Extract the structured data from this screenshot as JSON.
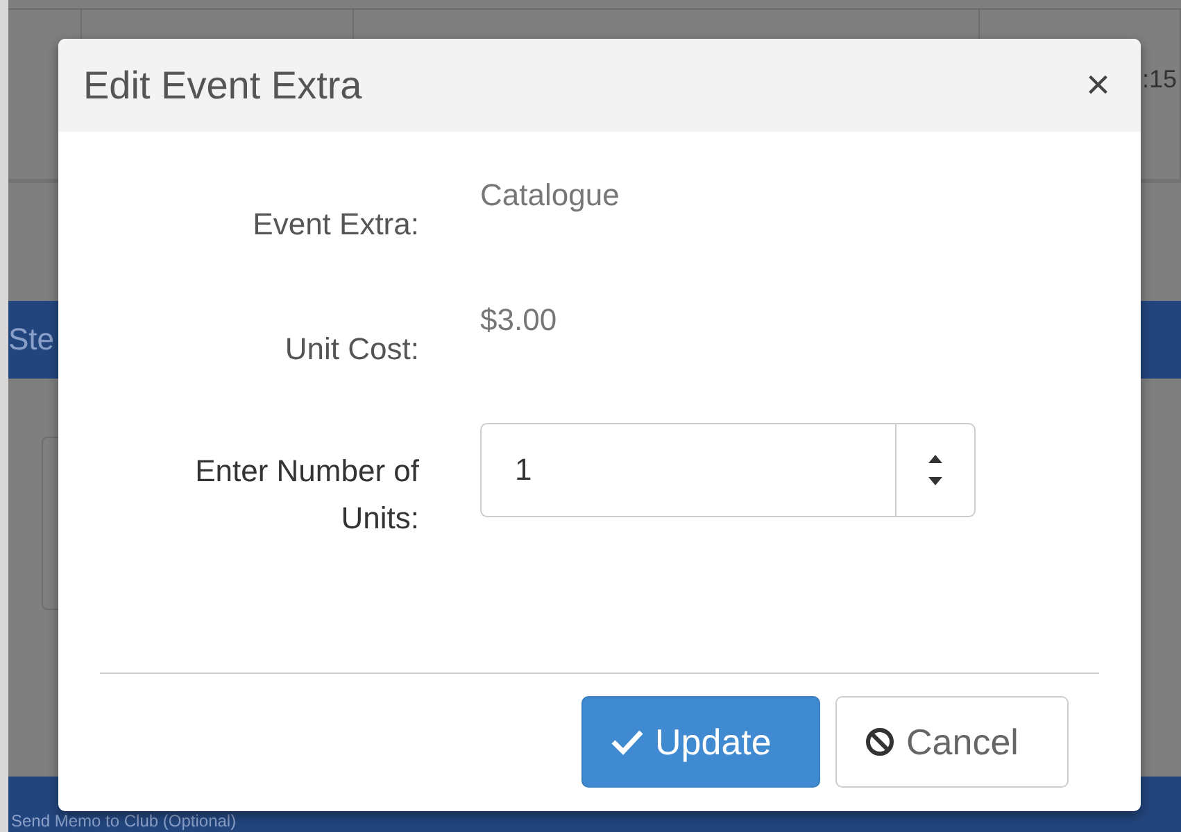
{
  "background": {
    "table_cell": ":15",
    "step_bar": "Ste",
    "memo_bar": "Send Memo to Club (Optional)"
  },
  "dialog": {
    "title": "Edit Event Extra",
    "close": "×",
    "fields": [
      {
        "kind": "text",
        "label": "Event Extra:",
        "value": "Catalogue"
      },
      {
        "kind": "text",
        "label": "Unit Cost:",
        "value": "$3.00"
      },
      {
        "kind": "number",
        "label": "Enter Number of Units:",
        "value": "1"
      }
    ],
    "buttons": [
      {
        "kind": "primary",
        "label": "Update"
      },
      {
        "kind": "cancel",
        "label": "Cancel"
      }
    ]
  }
}
